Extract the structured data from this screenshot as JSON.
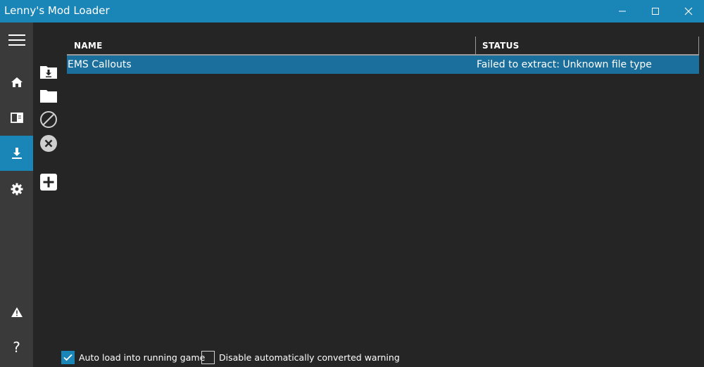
{
  "window": {
    "title": "Lenny's Mod Loader",
    "controls": [
      "minimize-icon",
      "maximize-icon",
      "close-icon"
    ]
  },
  "sidebar": {
    "items": [
      {
        "name": "menu",
        "icon": "hamburger-icon",
        "active": false
      },
      {
        "name": "home",
        "icon": "home-icon",
        "active": false
      },
      {
        "name": "library",
        "icon": "book-icon",
        "active": false
      },
      {
        "name": "downloads",
        "icon": "download-icon",
        "active": true
      },
      {
        "name": "settings",
        "icon": "gear-icon",
        "active": false
      }
    ],
    "bottom_items": [
      {
        "name": "warnings",
        "icon": "warning-icon"
      },
      {
        "name": "help",
        "icon": "help-icon",
        "label": "?"
      }
    ],
    "accent": "#1a86b8"
  },
  "toolbar": {
    "icons": [
      "install-folder-icon",
      "open-folder-icon",
      "disable-icon",
      "remove-icon",
      "add-icon"
    ]
  },
  "grid": {
    "columns": [
      "NAME",
      "STATUS"
    ],
    "rows": [
      {
        "name": "EMS Callouts",
        "status": "Failed to extract: Unknown file type",
        "selected": true
      }
    ]
  },
  "footer": {
    "auto_load": {
      "label": "Auto load into running game",
      "checked": true
    },
    "disable_warning": {
      "label": "Disable automatically converted warning",
      "checked": false
    }
  }
}
